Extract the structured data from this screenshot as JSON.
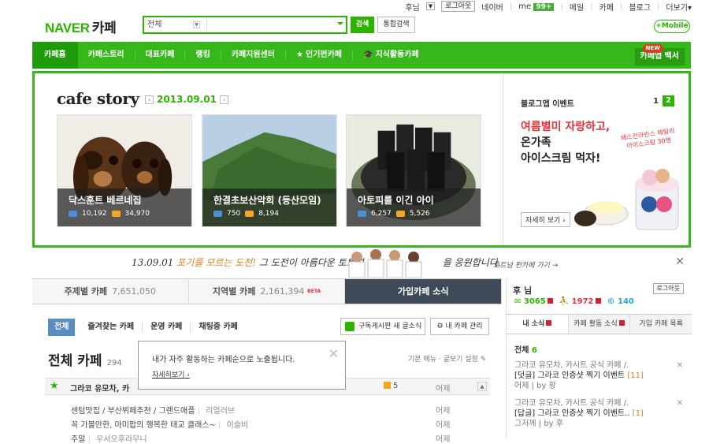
{
  "top": {
    "user": "후님",
    "logout": "로그아웃",
    "links": [
      "네이버",
      "me",
      "메일",
      "카페",
      "블로그",
      "더보기"
    ],
    "me_badge": "99+"
  },
  "logo": {
    "naver": "NAVER",
    "cafe": "카페"
  },
  "search": {
    "category": "전체",
    "button": "검색",
    "integrated": "통합검색",
    "mobile": "+Mobile"
  },
  "nav": {
    "items": [
      "카페홈",
      "카페스토리",
      "대표카페",
      "랭킹",
      "카페지원센터",
      "인기펀카페",
      "지식활동카페"
    ],
    "app": "카페앱 백서",
    "new": "NEW"
  },
  "story": {
    "title": "cafe story",
    "date": "2013.09.01",
    "cards": [
      {
        "name": "닥스훈트 베르네집",
        "members": "10,192",
        "posts": "34,970"
      },
      {
        "name": "한결초보산악회 (등산모임)",
        "members": "750",
        "posts": "8,194"
      },
      {
        "name": "아토피를 이긴 아이",
        "members": "6,257",
        "posts": "5,526"
      }
    ],
    "event_label": "블로그앱 이벤트",
    "pager": [
      "1",
      "2"
    ],
    "promo_line1": "여름별미 자랑하고,",
    "promo_line2": "온가족",
    "promo_line3": "아이스크림 먹자!",
    "promo_detail": "자세히 보기 ›",
    "promo_sub": "배스킨라빈스 패밀리 아이스크림 30명"
  },
  "banner": {
    "date": "13.09.01",
    "text_hl": "포기를 모르는 도전!",
    "text_rest": "그 도전이 아름다운 토트넘",
    "text_end": "을 응원합니다.",
    "link": "토트넘 펀카페 가기 →"
  },
  "tabs": [
    {
      "label": "주제별 카페",
      "count": "7,651,050"
    },
    {
      "label": "지역별 카페",
      "count": "2,161,394",
      "badge": "BETA"
    },
    {
      "label": "가입카페 소식",
      "count": ""
    }
  ],
  "subtabs": [
    "전체",
    "즐겨찾는 카페",
    "운영 카페",
    "채팅중 카페"
  ],
  "buttons": {
    "subscribe": "구독게시판 새 글소식",
    "manage": "내 카페 관리"
  },
  "all": {
    "title": "전체 카페",
    "count": "294",
    "settings": "기본 메뉴 · 글보기 설정"
  },
  "tooltip": {
    "text": "내가 자주 활동하는 카페순으로 노출됩니다.",
    "link": "자세히보기"
  },
  "fav": {
    "name": "그라코 유모차, 카",
    "count": "5",
    "date": "어제"
  },
  "posts": [
    {
      "title": "센텀맛집 / 부산뷔페추천 / 그랜드애플",
      "author": "리얼러브",
      "date": "어제"
    },
    {
      "title": "꼭 가볼만한, 마미팝의 행복한 태교 클래스~",
      "author": "이슬비",
      "date": "어제"
    },
    {
      "title": "주말",
      "author": "우서오후라무니",
      "date": "어제"
    }
  ],
  "rpanel": {
    "user": "후 님",
    "logout": "로그아웃",
    "stats": [
      "3065",
      "1972",
      "140"
    ],
    "tabs": [
      "내 소식",
      "카페 활동 소식",
      "가입 카페 목록"
    ],
    "all_label": "전체",
    "all_count": "6",
    "items": [
      {
        "src": "그라코 유모차, 카시트 공식 카페 /.",
        "title": "[덧글] 그라코 인증샷 찍기 이벤트",
        "cnt": "[11]",
        "by": "어제 | by 황"
      },
      {
        "src": "그라코 유모차, 카시트 공식 카페 /.",
        "title": "[답글] 그라코 인증샷 찍기 이벤트..",
        "cnt": "[1]",
        "by": "그저께 | by 후"
      }
    ]
  }
}
